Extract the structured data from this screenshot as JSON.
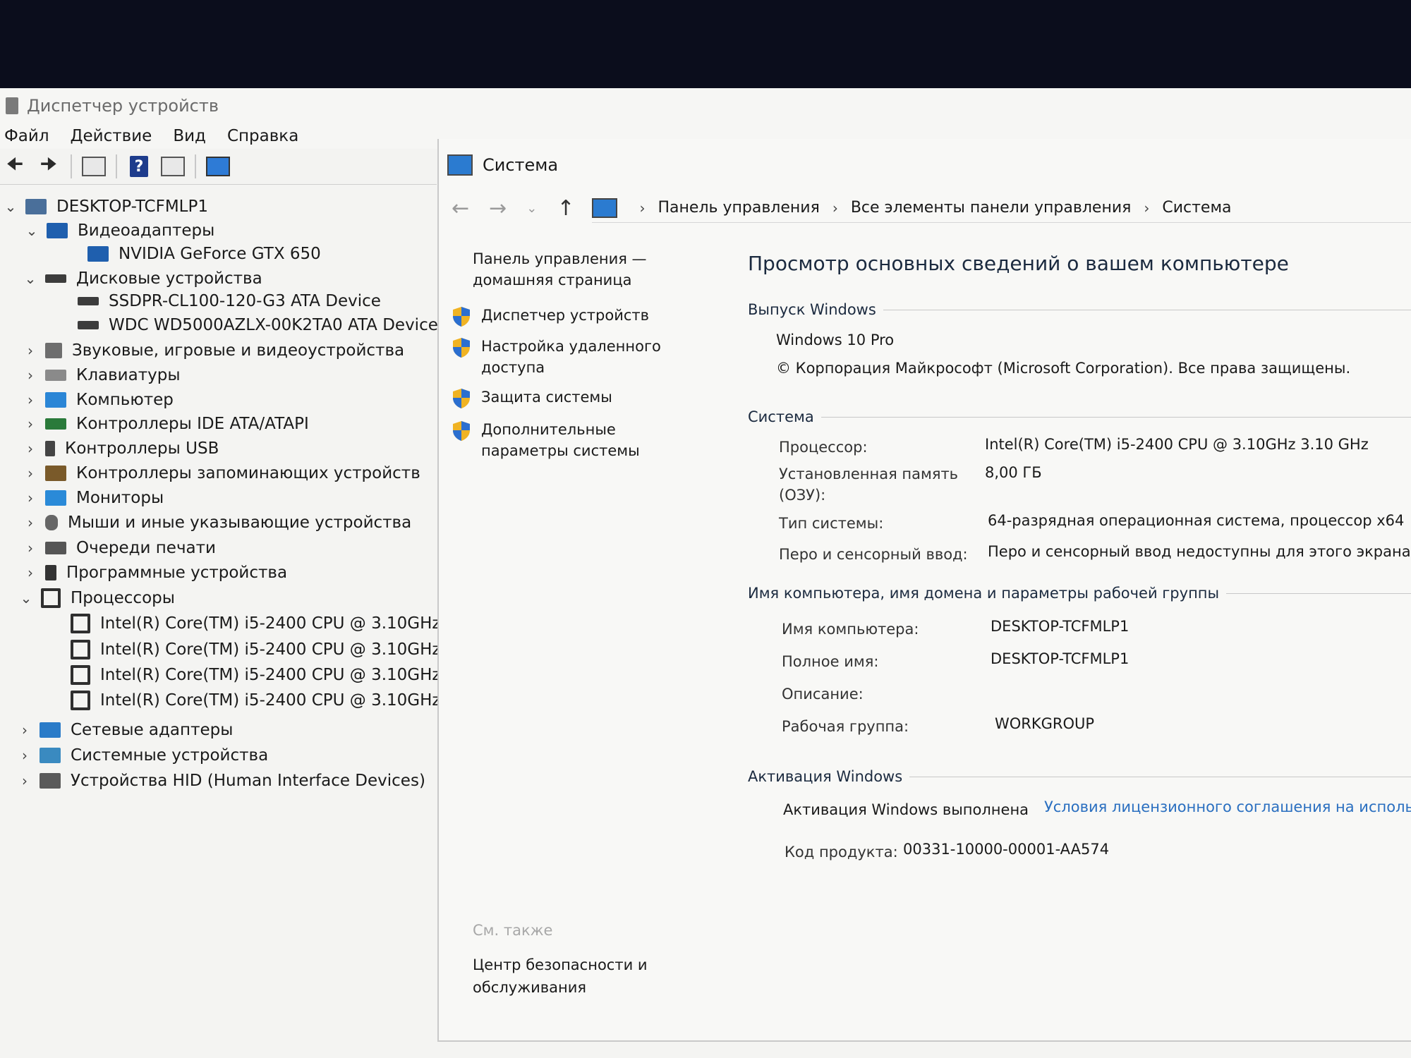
{
  "device_manager": {
    "title": "Диспетчер устройств",
    "menu": [
      "Файл",
      "Действие",
      "Вид",
      "Справка"
    ],
    "tree": {
      "root": "DESKTOP-TCFMLP1",
      "items": [
        {
          "label": "Видеоадаптеры",
          "expanded": true
        },
        {
          "label": "NVIDIA GeForce GTX 650"
        },
        {
          "label": "Дисковые устройства",
          "expanded": true
        },
        {
          "label": "SSDPR-CL100-120-G3 ATA Device"
        },
        {
          "label": "WDC WD5000AZLX-00K2TA0 ATA Device"
        },
        {
          "label": "Звуковые, игровые и видеоустройства"
        },
        {
          "label": "Клавиатуры"
        },
        {
          "label": "Компьютер"
        },
        {
          "label": "Контроллеры IDE ATA/ATAPI"
        },
        {
          "label": "Контроллеры USB"
        },
        {
          "label": "Контроллеры запоминающих устройств"
        },
        {
          "label": "Мониторы"
        },
        {
          "label": "Мыши и иные указывающие устройства"
        },
        {
          "label": "Очереди печати"
        },
        {
          "label": "Программные устройства"
        },
        {
          "label": "Процессоры",
          "expanded": true
        },
        {
          "label": "Intel(R) Core(TM) i5-2400 CPU @ 3.10GHz"
        },
        {
          "label": "Intel(R) Core(TM) i5-2400 CPU @ 3.10GHz"
        },
        {
          "label": "Intel(R) Core(TM) i5-2400 CPU @ 3.10GHz"
        },
        {
          "label": "Intel(R) Core(TM) i5-2400 CPU @ 3.10GHz"
        },
        {
          "label": "Сетевые адаптеры"
        },
        {
          "label": "Системные устройства"
        },
        {
          "label": "Устройства HID (Human Interface Devices)"
        }
      ]
    }
  },
  "system": {
    "title": "Система",
    "breadcrumb": [
      "Панель управления",
      "Все элементы панели управления",
      "Система"
    ],
    "left": {
      "home": "Панель управления — домашняя страница",
      "links": [
        "Диспетчер устройств",
        "Настройка удаленного доступа",
        "Защита системы",
        "Дополнительные параметры системы"
      ],
      "see_also": "См. также",
      "security_center": "Центр безопасности и обслуживания"
    },
    "heading": "Просмотр основных сведений о вашем компьютере",
    "edition": {
      "section": "Выпуск Windows",
      "name": "Windows 10 Pro",
      "copyright": "© Корпорация Майкрософт (Microsoft Corporation). Все права защищены."
    },
    "system_info": {
      "section": "Система",
      "processor_label": "Процессор:",
      "processor": "Intel(R) Core(TM) i5-2400 CPU @ 3.10GHz   3.10 GHz",
      "ram_label": "Установленная память (ОЗУ):",
      "ram": "8,00 ГБ",
      "type_label": "Тип системы:",
      "type": "64-разрядная операционная система, процессор x64",
      "pen_label": "Перо и сенсорный ввод:",
      "pen": "Перо и сенсорный ввод недоступны для этого экрана"
    },
    "computer_name": {
      "section": "Имя компьютера, имя домена и параметры рабочей группы",
      "name_label": "Имя компьютера:",
      "name": "DESKTOP-TCFMLP1",
      "full_label": "Полное имя:",
      "full": "DESKTOP-TCFMLP1",
      "desc_label": "Описание:",
      "group_label": "Рабочая группа:",
      "group": "WORKGROUP"
    },
    "activation": {
      "section": "Активация Windows",
      "status": "Активация Windows выполнена",
      "license_link": "Условия лицензионного соглашения на исполь",
      "product_label": "Код продукта:",
      "product": "00331-10000-00001-AA574"
    }
  }
}
